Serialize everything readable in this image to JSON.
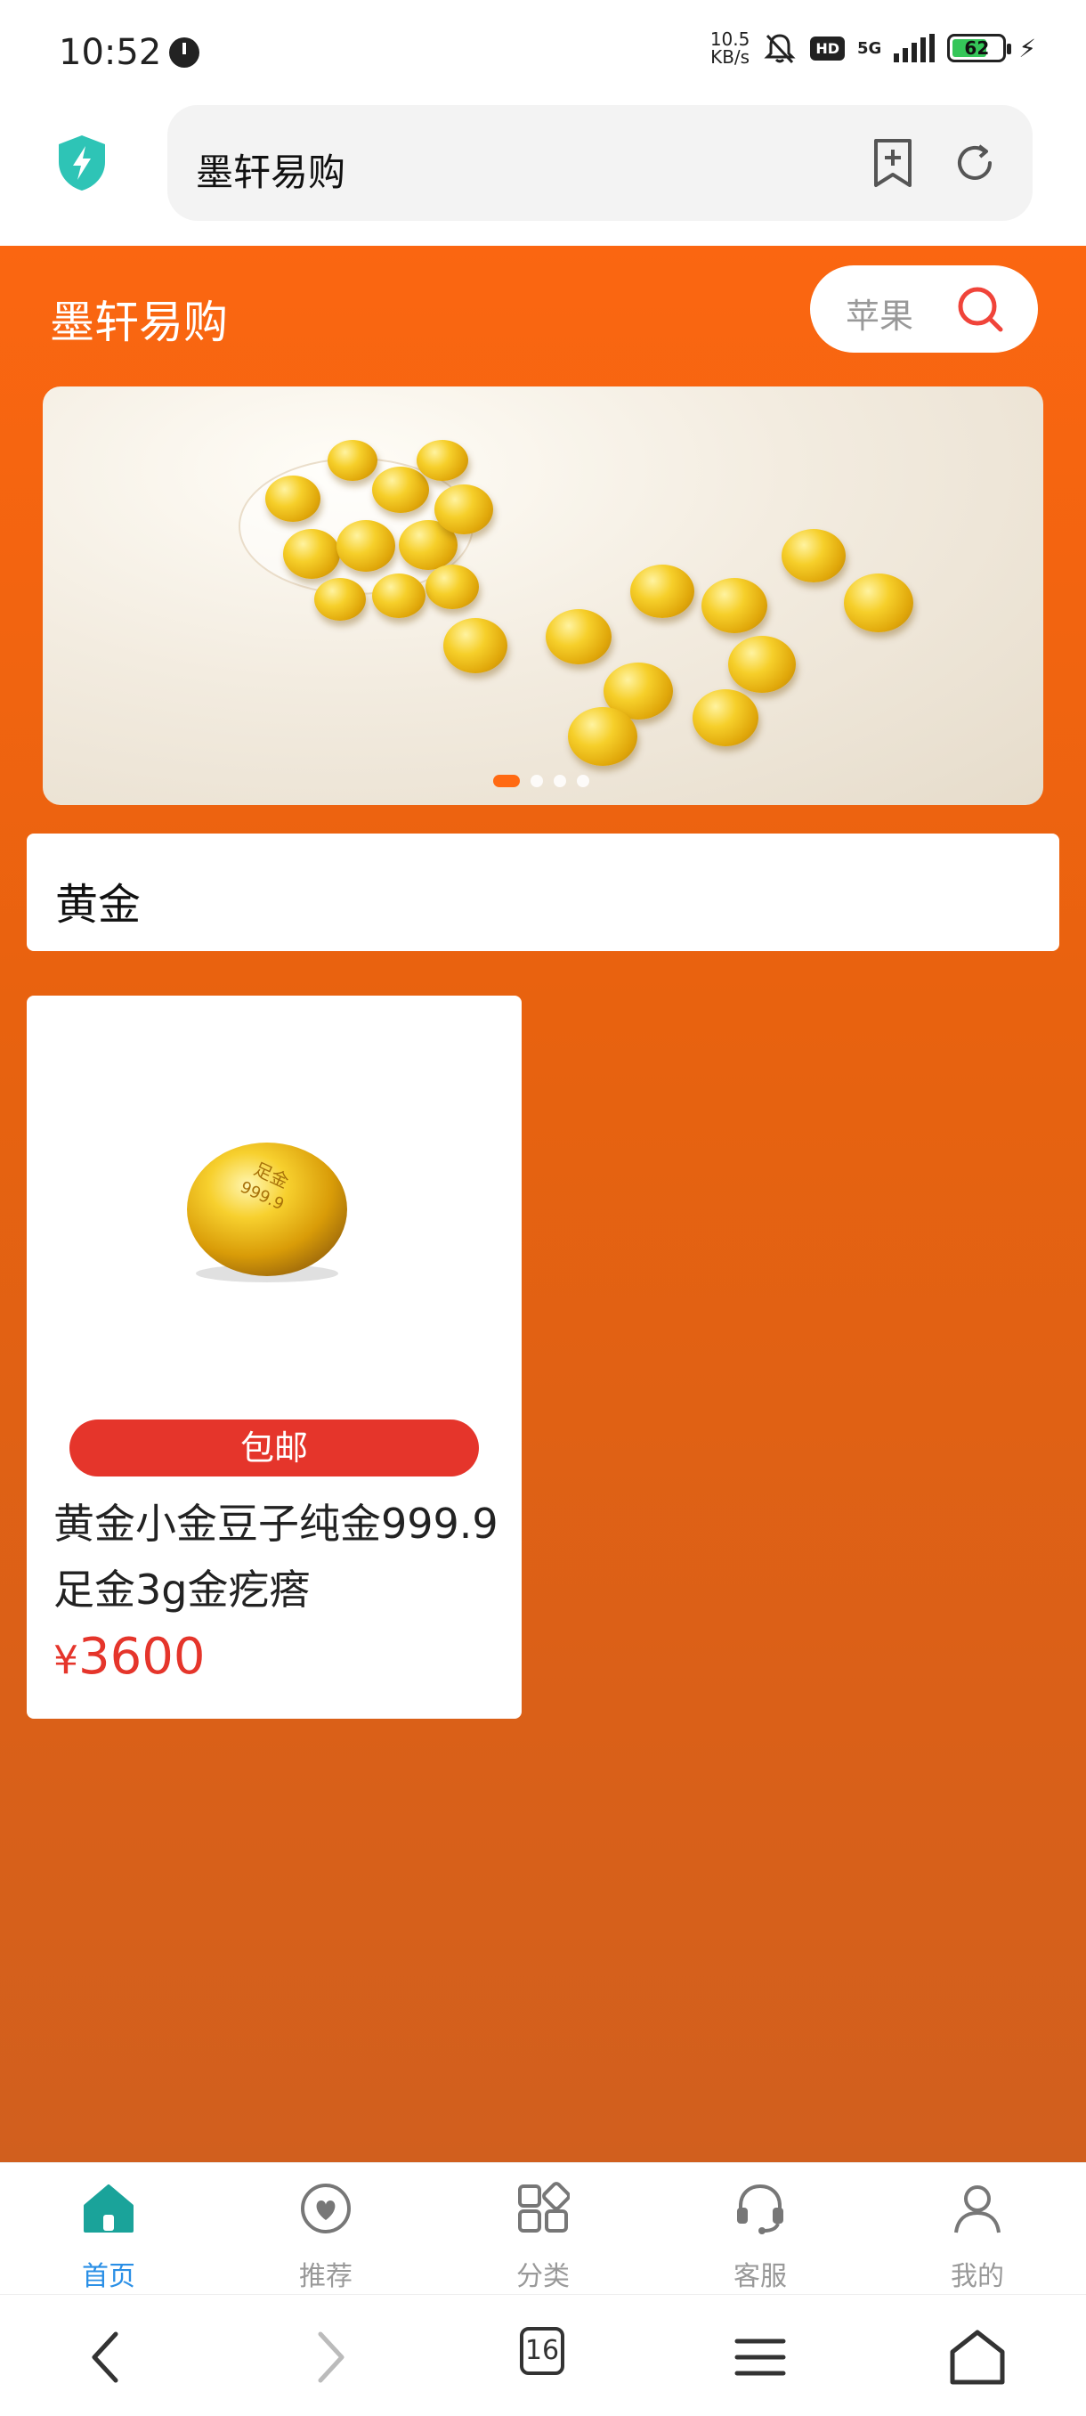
{
  "status_bar": {
    "time": "10:52",
    "net_speed_value": "10.5",
    "net_speed_unit": "KB/s",
    "hd": "HD",
    "network": "5G",
    "battery": "62"
  },
  "browser": {
    "url_title": "墨轩易购"
  },
  "header": {
    "site_title": "墨轩易购",
    "search_placeholder": "苹果"
  },
  "banner": {
    "slide_count": 4,
    "active_slide": 1
  },
  "category": {
    "label": "黄金"
  },
  "products": [
    {
      "badge": "包邮",
      "title": "黄金小金豆子纯金999.9足金3g金疙瘩",
      "currency": "¥",
      "price": "3600",
      "stamp_line1": "足金",
      "stamp_line2": "999.9"
    }
  ],
  "tabbar": {
    "items": [
      {
        "label": "首页",
        "icon": "home-icon",
        "active": true
      },
      {
        "label": "推荐",
        "icon": "heart-icon",
        "active": false
      },
      {
        "label": "分类",
        "icon": "category-icon",
        "active": false
      },
      {
        "label": "客服",
        "icon": "headset-icon",
        "active": false
      },
      {
        "label": "我的",
        "icon": "user-icon",
        "active": false
      }
    ]
  },
  "navbar": {
    "tab_count": "16"
  },
  "colors": {
    "accent_orange": "#fb6611",
    "price_red": "#e5352b",
    "active_tab_blue": "#2a8fe6",
    "shield_teal": "#2ec4b6"
  }
}
